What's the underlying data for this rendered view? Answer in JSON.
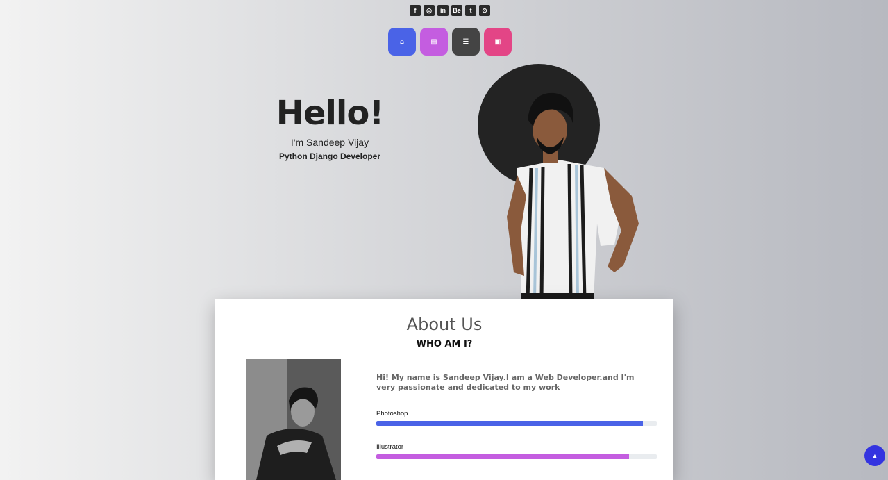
{
  "social": [
    {
      "name": "facebook-icon",
      "glyph": "f"
    },
    {
      "name": "instagram-icon",
      "glyph": "◎"
    },
    {
      "name": "linkedin-icon",
      "glyph": "in"
    },
    {
      "name": "behance-icon",
      "glyph": "Be"
    },
    {
      "name": "twitter-icon",
      "glyph": "t"
    },
    {
      "name": "github-icon",
      "glyph": "⊙"
    }
  ],
  "nav": [
    {
      "name": "home-icon",
      "glyph": "⌂",
      "color": "#4a63e7"
    },
    {
      "name": "id-card-icon",
      "glyph": "▤",
      "color": "#c45de0"
    },
    {
      "name": "list-icon",
      "glyph": "☰",
      "color": "#444444"
    },
    {
      "name": "contact-icon",
      "glyph": "▣",
      "color": "#e34586"
    }
  ],
  "hero": {
    "greeting": "Hello!",
    "intro": "I'm Sandeep Vijay",
    "role": "Python Django Developer"
  },
  "about": {
    "title": "About Us",
    "subtitle": "WHO AM I?",
    "text": "Hi! My name is Sandeep Vijay.I am a Web Developer.and I'm very passionate and dedicated to my work",
    "skills": [
      {
        "label": "Photoshop",
        "level": 0.95,
        "color": "#4a63e7"
      },
      {
        "label": "Illustrator",
        "level": 0.9,
        "color": "#c45de0"
      }
    ]
  },
  "scroll_top_glyph": "▲"
}
